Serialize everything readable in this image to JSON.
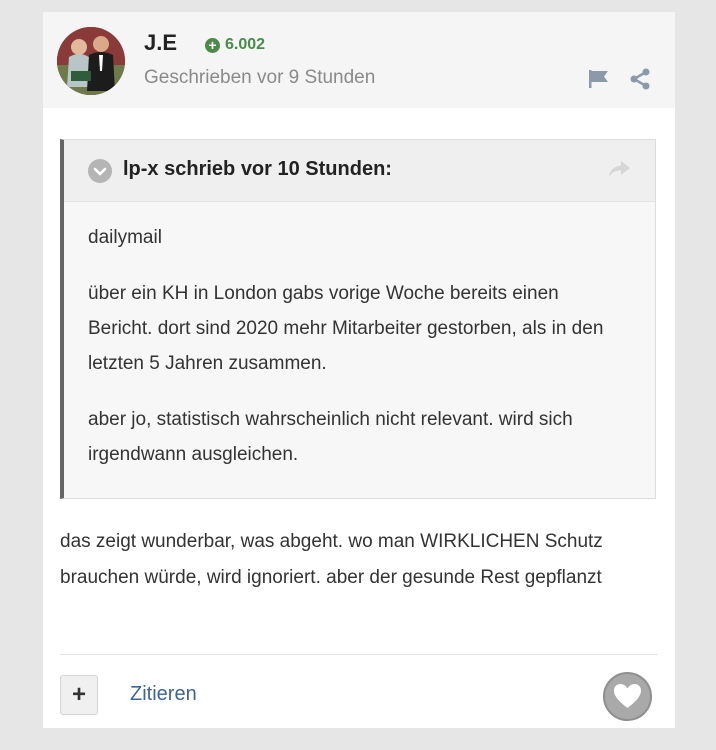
{
  "post": {
    "author": {
      "name": "J.E",
      "reputation": "6.002",
      "avatar": "author-avatar"
    },
    "date": "Geschrieben vor 9 Stunden",
    "icons": {
      "flag": "flag-icon",
      "share": "share-icon"
    },
    "quote": {
      "citation": "lp-x schrieb vor 10 Stunden:",
      "toggle_icon": "chevron-down-icon",
      "link_icon": "share-arrow-icon",
      "paragraphs": [
        "dailymail",
        "über ein KH in London gabs vorige Woche bereits einen Bericht. dort sind 2020 mehr Mitarbeiter gestorben, als in den letzten 5 Jahren zusammen.",
        "aber jo, statistisch wahrscheinlich nicht relevant. wird sich irgendwann ausgleichen."
      ]
    },
    "content": "das zeigt wunderbar, was abgeht. wo man WIRKLICHEN Schutz brauchen würde, wird ignoriert. aber der gesunde Rest gepflanzt",
    "actions": {
      "multiquote_label": "+",
      "quote_label": "Zitieren",
      "like_icon": "heart-icon"
    }
  },
  "colors": {
    "background": "#e6e6e6",
    "header": "#f5f5f5",
    "reputation": "#4a8a4a",
    "link": "#3d6594",
    "quote_border": "#666666"
  }
}
